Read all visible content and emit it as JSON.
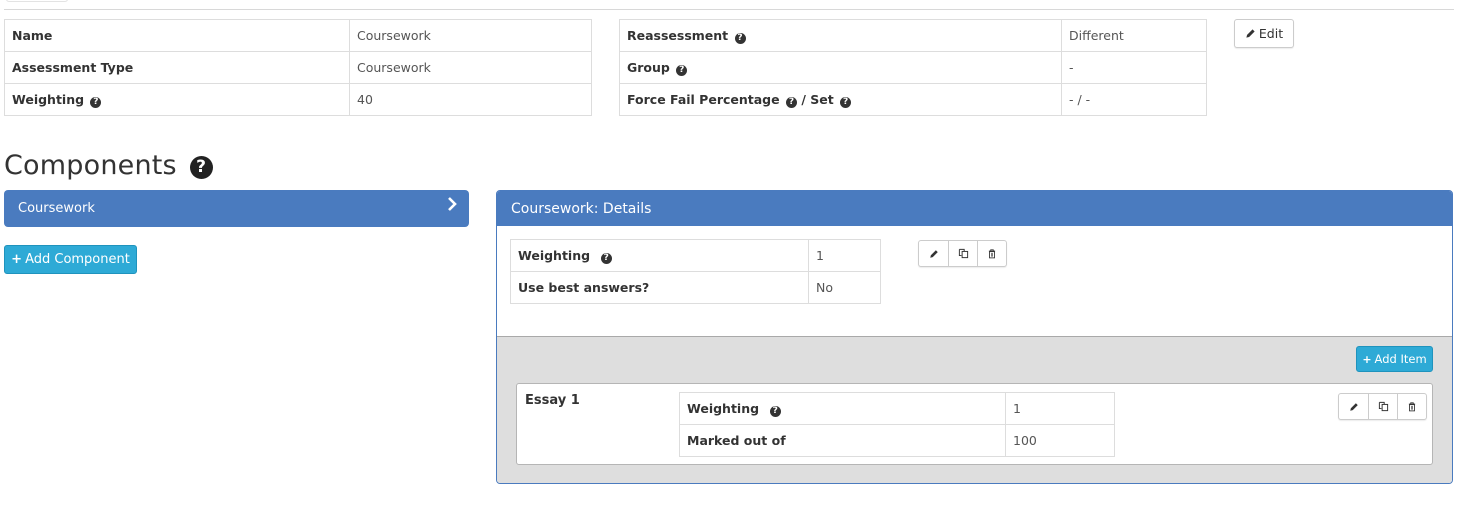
{
  "assessment": {
    "left_table": [
      {
        "label": "Name",
        "help": false,
        "value": "Coursework"
      },
      {
        "label": "Assessment Type",
        "help": false,
        "value": "Coursework"
      },
      {
        "label": "Weighting",
        "help": true,
        "value": "40"
      }
    ],
    "right_table": {
      "reassessment": {
        "label": "Reassessment",
        "value": "Different"
      },
      "group": {
        "label": "Group",
        "value": "-"
      },
      "force_fail": {
        "label_a": "Force Fail Percentage",
        "label_sep": "/ Set",
        "value": "- / -"
      }
    },
    "edit_label": "Edit"
  },
  "components": {
    "heading": "Components",
    "list": [
      {
        "label": "Coursework",
        "selected": true
      }
    ],
    "add_component_label": "Add Component"
  },
  "details": {
    "title": "Coursework: Details",
    "rows": [
      {
        "label": "Weighting",
        "help": true,
        "value": "1"
      },
      {
        "label": "Use best answers?",
        "help": false,
        "value": "No"
      }
    ],
    "actions": [
      "edit",
      "copy",
      "delete"
    ],
    "add_item_label": "Add Item",
    "items": [
      {
        "title": "Essay 1",
        "rows": [
          {
            "label": "Weighting",
            "help": true,
            "value": "1"
          },
          {
            "label": "Marked out of",
            "help": false,
            "value": "100"
          }
        ]
      }
    ]
  },
  "icons": {
    "help": "?",
    "chevron": "›",
    "plus": "+"
  },
  "colors": {
    "primary": "#4a7bbf",
    "info": "#2eaad6",
    "items_bg": "#dedede"
  }
}
